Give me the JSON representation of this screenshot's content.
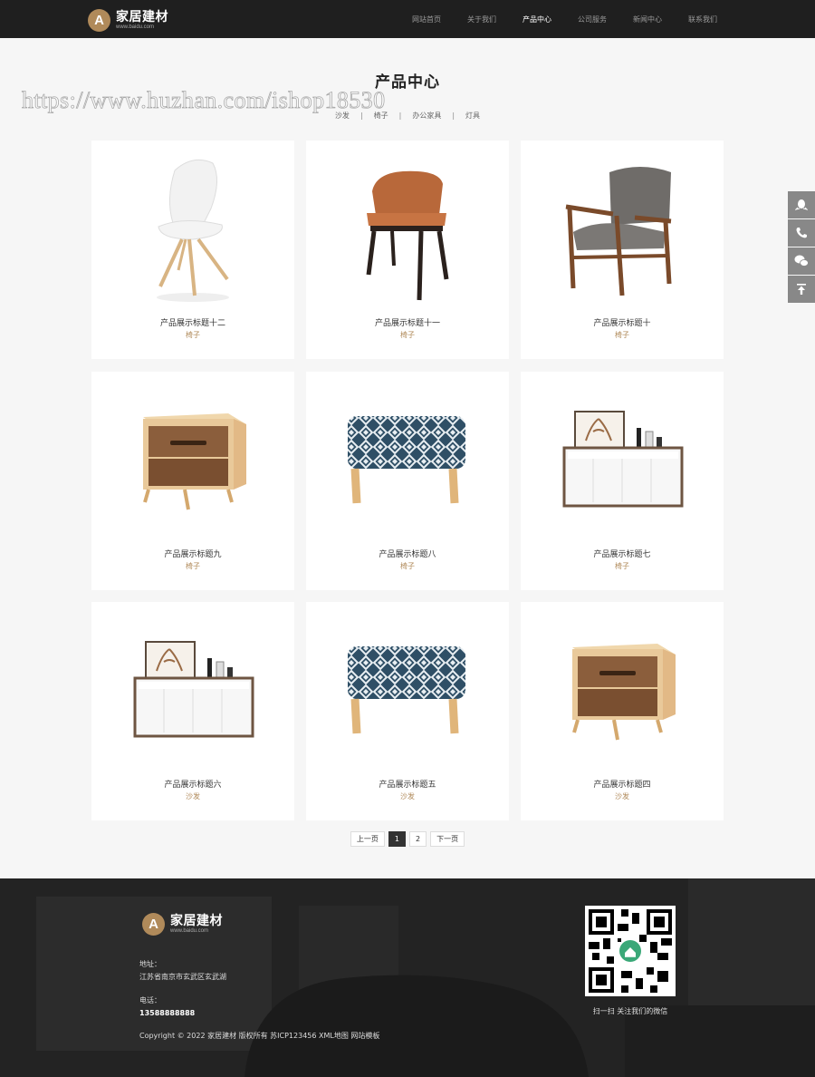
{
  "brand": {
    "name": "家居建材",
    "domain": "www.baidu.com"
  },
  "nav": [
    "网站首页",
    "关于我们",
    "产品中心",
    "公司服务",
    "新闻中心",
    "联系我们"
  ],
  "nav_active_index": 2,
  "page": {
    "title": "产品中心",
    "watermark": "https://www.huzhan.com/ishop18530"
  },
  "categories": [
    "沙发",
    "椅子",
    "办公家具",
    "灯具"
  ],
  "category_separator": "|",
  "products": [
    {
      "title": "产品展示标题十二",
      "category": "椅子",
      "image": "white-chair"
    },
    {
      "title": "产品展示标题十一",
      "category": "椅子",
      "image": "leather-chair"
    },
    {
      "title": "产品展示标题十",
      "category": "椅子",
      "image": "armchair"
    },
    {
      "title": "产品展示标题九",
      "category": "椅子",
      "image": "nightstand"
    },
    {
      "title": "产品展示标题八",
      "category": "椅子",
      "image": "ottoman"
    },
    {
      "title": "产品展示标题七",
      "category": "椅子",
      "image": "sideboard"
    },
    {
      "title": "产品展示标题六",
      "category": "沙发",
      "image": "sideboard"
    },
    {
      "title": "产品展示标题五",
      "category": "沙发",
      "image": "ottoman"
    },
    {
      "title": "产品展示标题四",
      "category": "沙发",
      "image": "nightstand"
    }
  ],
  "pagination": {
    "prev": "上一页",
    "pages": [
      "1",
      "2"
    ],
    "current": "1",
    "next": "下一页"
  },
  "side_tools": [
    "qq-icon",
    "phone-icon",
    "wechat-icon",
    "back-to-top-icon"
  ],
  "footer": {
    "address_label": "地址：",
    "address": "江苏省南京市玄武区玄武湖",
    "phone_label": "电话：",
    "phone": "13588888888",
    "copyright": "Copyright © 2022 家居建材 版权所有 苏ICP123456 XML地图 网站模板",
    "qr_caption": "扫一扫 关注我们的微信"
  },
  "colors": {
    "header_bg": "#1f1f1f",
    "accent": "#b08a5a",
    "footer_bg": "#232323",
    "page_bg": "#f6f6f6"
  }
}
